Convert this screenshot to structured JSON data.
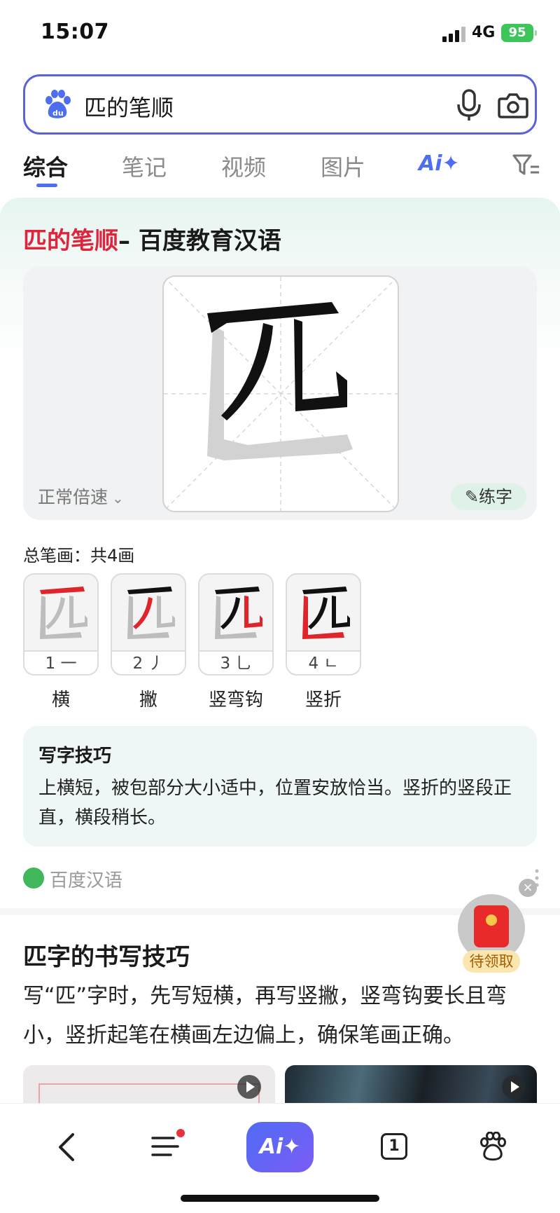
{
  "status_bar": {
    "time": "15:07",
    "network": "4G",
    "battery": "95"
  },
  "search": {
    "query": "匹的笔顺"
  },
  "tabs": [
    {
      "label": "综合",
      "active": true
    },
    {
      "label": "笔记"
    },
    {
      "label": "视频"
    },
    {
      "label": "图片"
    },
    {
      "label": "Ai✦"
    }
  ],
  "card": {
    "title_highlight": "匹的笔顺",
    "title_rest": "– 百度教育汉语",
    "speed_label": "正常倍速",
    "practice_label": "练字",
    "total_strokes": "总笔画：共4画",
    "strokes": [
      {
        "num": "1 一",
        "name": "横"
      },
      {
        "num": "2 丿",
        "name": "撇"
      },
      {
        "num": "3 乚",
        "name": "竖弯钩"
      },
      {
        "num": "4 ㄴ",
        "name": "竖折"
      }
    ],
    "tips_title": "写字技巧",
    "tips_body": "上横短，被包部分大小适中，位置安放恰当。竖折的竖段正直，横段稍长。",
    "source_name": "百度汉语"
  },
  "section": {
    "title": "匹字的书写技巧",
    "body": "写“匹”字时，先写短横，再写竖撇，竖弯钩要长且弯小，竖折起笔在横画左边偏上，确保笔画正确。"
  },
  "float_widget": {
    "label": "待领取",
    "close": "×"
  },
  "bottom_nav": {
    "ai_label": "Ai✦",
    "tab_count": "1"
  },
  "colors": {
    "accent": "#4e6ef2",
    "highlight": "#e0243c",
    "stroke_red": "#e0242c"
  }
}
